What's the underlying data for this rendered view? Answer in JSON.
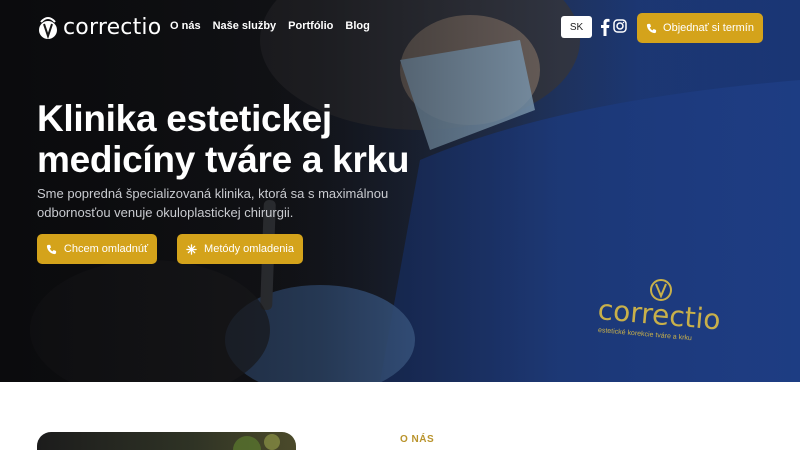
{
  "brand": {
    "name": "correctio",
    "logo_icon": "correctio-flower-icon"
  },
  "nav": {
    "items": [
      "O nás",
      "Naše služby",
      "Portfólio",
      "Blog"
    ]
  },
  "header": {
    "language": "SK",
    "social": [
      "facebook-icon",
      "instagram-icon"
    ],
    "cta_label": "Objednať si termín"
  },
  "hero": {
    "title": "Klinika estetickej medicíny tváre a krku",
    "subtitle": "Sme popredná špecializovaná klinika, ktorá sa s maximálnou odbornosťou venuje okuloplastickej chirurgii.",
    "buttons": [
      {
        "label": "Chcem omladnúť",
        "icon": "phone-icon"
      },
      {
        "label": "Metódy omladenia",
        "icon": "sparkle-icon"
      }
    ],
    "wall_brand": "correctio",
    "wall_brand_sub": "estetické korekcie tváre a krku"
  },
  "about": {
    "label": "O NÁS"
  },
  "colors": {
    "accent": "#d4a31b",
    "label_gold": "#b9932b"
  }
}
